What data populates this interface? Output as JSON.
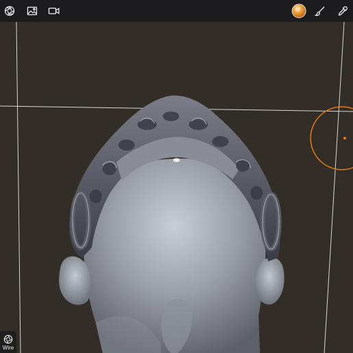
{
  "toolbar": {
    "left_icons": [
      "aperture-icon",
      "image-icon",
      "video-camera-icon"
    ],
    "right_icons": [
      "material-sphere-icon",
      "brush-icon",
      "eyedropper-icon"
    ],
    "material_color": "#f0a23c"
  },
  "viewport": {
    "background_color": "#332d27",
    "model_color": "#9a9ea6",
    "mask_color": "#4e4f5a",
    "brush_cursor_color": "#e47a14"
  },
  "bottom_left": {
    "wire_label": "Wire"
  }
}
